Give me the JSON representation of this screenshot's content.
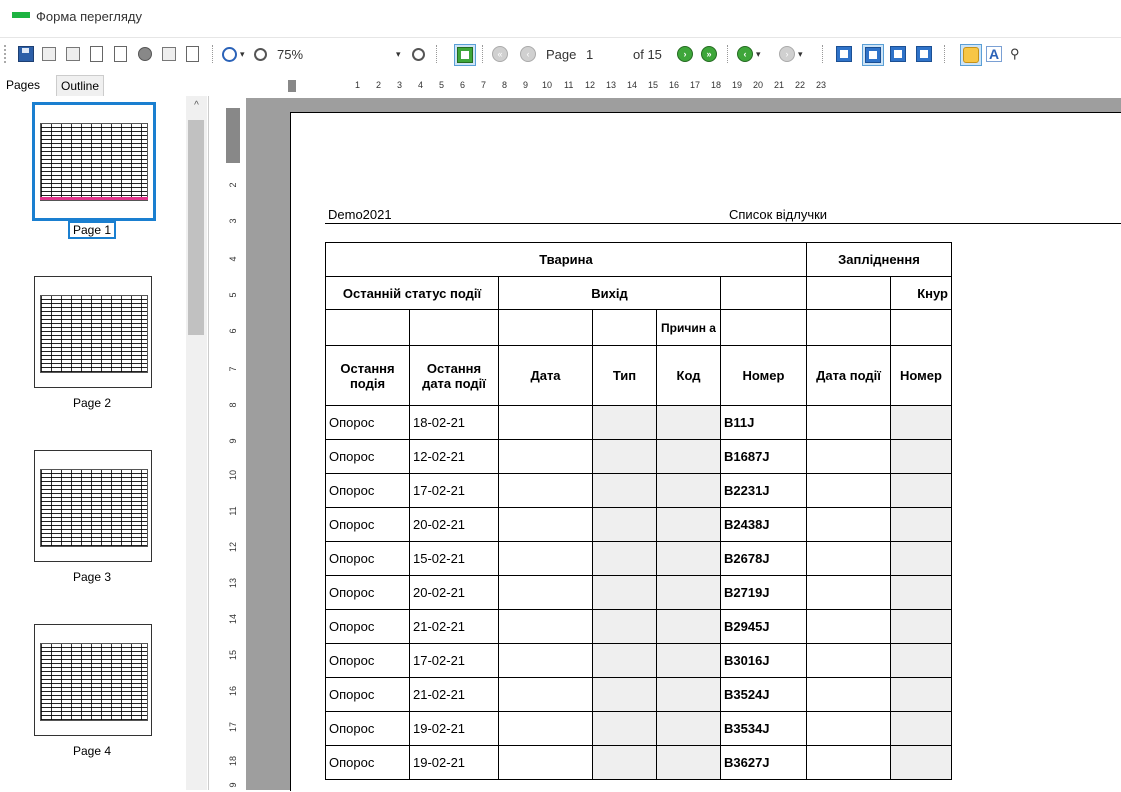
{
  "window": {
    "title": "Форма перегляду",
    "accent": "#1db341"
  },
  "toolbar": {
    "zoom_value": "75%",
    "page_label": "Page",
    "page_number": "1",
    "page_of": "of 15",
    "icons": [
      "save-icon",
      "open-icon",
      "blank-icon",
      "page-icon",
      "page-setup-icon",
      "record-icon",
      "print-icon",
      "export-icon",
      "zoom-icon",
      "zoom-out-icon",
      "zoom-in-icon",
      "thumbnails-icon",
      "first-page-icon",
      "prev-page-icon",
      "next-page-icon",
      "last-page-icon",
      "back-icon",
      "forward-icon",
      "single-page-icon",
      "two-page-icon",
      "multi-page-icon",
      "grid-page-icon",
      "hand-tool-icon",
      "text-select-icon",
      "find-icon"
    ]
  },
  "sidebar": {
    "tabs": [
      {
        "label": "Pages"
      },
      {
        "label": "Outline"
      }
    ],
    "pages": [
      {
        "label": "Page 1"
      },
      {
        "label": "Page 2"
      },
      {
        "label": "Page 3"
      },
      {
        "label": "Page 4"
      }
    ],
    "selected_color": "#1a7fd0"
  },
  "ruler": {
    "h_ticks": [
      "1",
      "2",
      "3",
      "4",
      "5",
      "6",
      "7",
      "8",
      "9",
      "10",
      "11",
      "12",
      "13",
      "14",
      "15",
      "16",
      "17",
      "18",
      "19",
      "20",
      "21",
      "22",
      "23"
    ],
    "v_ticks": [
      "2",
      "3",
      "4",
      "5",
      "6",
      "7",
      "8",
      "9",
      "10",
      "11",
      "12",
      "13",
      "14",
      "15",
      "16",
      "17",
      "18",
      "9"
    ]
  },
  "report": {
    "left_header": "Demo2021",
    "right_header": "Список відлучки",
    "groups": {
      "animal": "Тварина",
      "insemination": "Запліднення"
    },
    "subgroups": {
      "last_status": "Останній статус події",
      "exit": "Вихід",
      "boar": "Кнур"
    },
    "reason": "Причин а",
    "columns": [
      "Остання подія",
      "Остання дата події",
      "Дата",
      "Тип",
      "Код",
      "Номер",
      "Дата події",
      "Номер"
    ],
    "rows": [
      {
        "event": "Опорос",
        "date": "18-02-21",
        "number": "B11J"
      },
      {
        "event": "Опорос",
        "date": "12-02-21",
        "number": "B1687J"
      },
      {
        "event": "Опорос",
        "date": "17-02-21",
        "number": "B2231J"
      },
      {
        "event": "Опорос",
        "date": "20-02-21",
        "number": "B2438J"
      },
      {
        "event": "Опорос",
        "date": "15-02-21",
        "number": "B2678J"
      },
      {
        "event": "Опорос",
        "date": "20-02-21",
        "number": "B2719J"
      },
      {
        "event": "Опорос",
        "date": "21-02-21",
        "number": "B2945J"
      },
      {
        "event": "Опорос",
        "date": "17-02-21",
        "number": "B3016J"
      },
      {
        "event": "Опорос",
        "date": "21-02-21",
        "number": "B3524J"
      },
      {
        "event": "Опорос",
        "date": "19-02-21",
        "number": "B3534J"
      },
      {
        "event": "Опорос",
        "date": "19-02-21",
        "number": "B3627J"
      }
    ]
  }
}
